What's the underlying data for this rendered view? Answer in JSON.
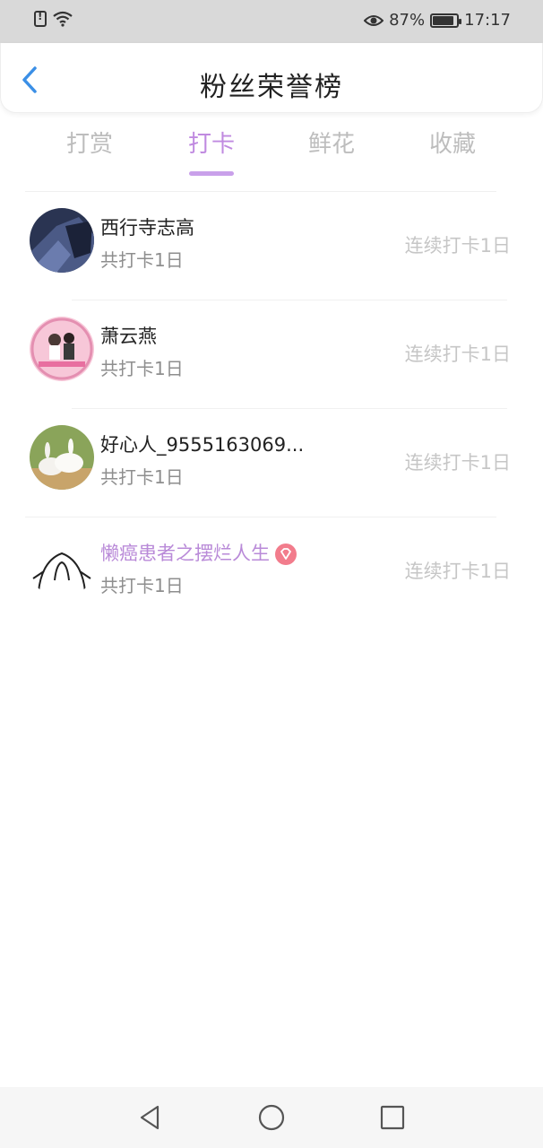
{
  "status_bar": {
    "battery_percent": "87%",
    "time": "17:17"
  },
  "header": {
    "title": "粉丝荣誉榜"
  },
  "tabs": [
    {
      "label": "打赏"
    },
    {
      "label": "打卡"
    },
    {
      "label": "鲜花"
    },
    {
      "label": "收藏"
    }
  ],
  "active_tab": "打卡",
  "fans": [
    {
      "name": "西行寺志高",
      "total": "共打卡1日",
      "streak": "连续打卡1日"
    },
    {
      "name": "萧云燕",
      "total": "共打卡1日",
      "streak": "连续打卡1日"
    },
    {
      "name": "好心人_9555163069...",
      "total": "共打卡1日",
      "streak": "连续打卡1日"
    },
    {
      "name": "懒癌患者之摆烂人生",
      "total": "共打卡1日",
      "streak": "连续打卡1日",
      "vip": true
    }
  ],
  "colors": {
    "accent": "#c08ae0",
    "vip_name": "#b98ad8",
    "vip_badge": "#f27c8c"
  }
}
